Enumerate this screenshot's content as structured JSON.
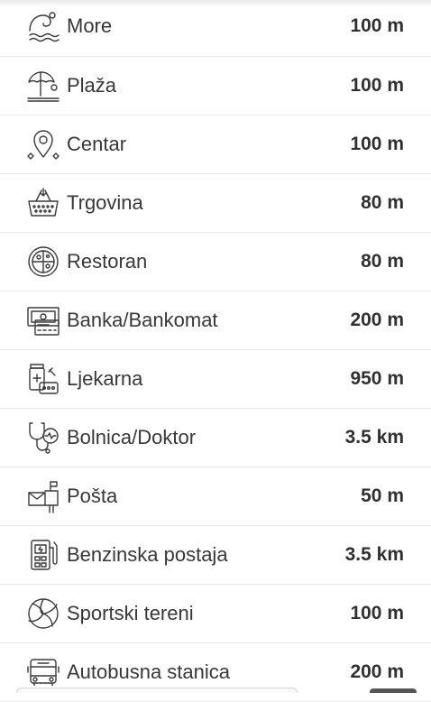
{
  "amenities": [
    {
      "label": "More",
      "distance": "100 m",
      "icon": "sea-waves-icon"
    },
    {
      "label": "Plaža",
      "distance": "100 m",
      "icon": "beach-umbrella-icon"
    },
    {
      "label": "Centar",
      "distance": "100 m",
      "icon": "map-pin-icon"
    },
    {
      "label": "Trgovina",
      "distance": "80 m",
      "icon": "shopping-basket-icon"
    },
    {
      "label": "Restoran",
      "distance": "80 m",
      "icon": "pizza-plate-icon"
    },
    {
      "label": "Banka/Bankomat",
      "distance": "200 m",
      "icon": "atm-card-icon"
    },
    {
      "label": "Ljekarna",
      "distance": "950 m",
      "icon": "pharmacy-pills-icon"
    },
    {
      "label": "Bolnica/Doktor",
      "distance": "3.5 km",
      "icon": "stethoscope-icon"
    },
    {
      "label": "Pošta",
      "distance": "50 m",
      "icon": "mailbox-icon"
    },
    {
      "label": "Benzinska postaja",
      "distance": "3.5 km",
      "icon": "fuel-pump-icon"
    },
    {
      "label": "Sportski tereni",
      "distance": "100 m",
      "icon": "volleyball-icon"
    },
    {
      "label": "Autobusna stanica",
      "distance": "200 m",
      "icon": "bus-icon"
    }
  ]
}
